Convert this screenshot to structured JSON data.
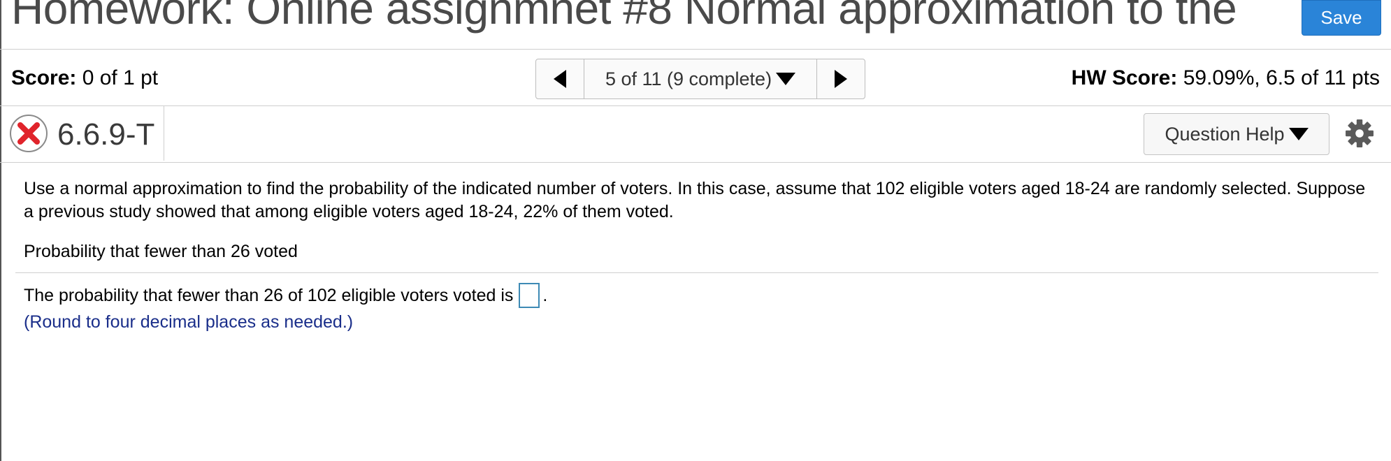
{
  "header": {
    "title": "Homework: Online assignmnet #8 Normal approximation to the",
    "save_label": "Save"
  },
  "score_bar": {
    "score_label": "Score:",
    "score_value": "0 of 1 pt",
    "nav_position": "5 of 11 (9 complete)",
    "hw_score_label": "HW Score:",
    "hw_score_value": "59.09%, 6.5 of 11 pts"
  },
  "question_bar": {
    "question_id": "6.6.9-T",
    "status": "incorrect",
    "help_label": "Question Help"
  },
  "question": {
    "prompt": "Use a normal approximation to find the probability of the indicated number of voters. In this case, assume that 102 eligible voters aged 18-24 are randomly selected. Suppose a previous study showed that among eligible voters aged 18-24, 22% of them voted.",
    "sub_prompt": "Probability that fewer than 26 voted",
    "answer_prefix": "The probability that fewer than 26 of 102 eligible voters voted is",
    "answer_suffix": ".",
    "answer_value": "",
    "hint": "(Round to four decimal places as needed.)"
  },
  "colors": {
    "save_button": "#2a84d8",
    "incorrect_icon": "#e0242b",
    "hint_text": "#1a2e8a",
    "answer_box_border": "#3e8ab5"
  },
  "icons": [
    "incorrect-x-icon",
    "prev-arrow-icon",
    "next-arrow-icon",
    "dropdown-arrow-icon",
    "gear-icon"
  ]
}
